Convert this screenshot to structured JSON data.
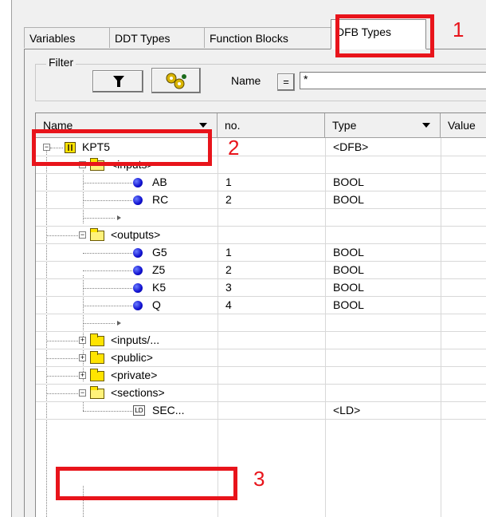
{
  "tabs": [
    {
      "label": "Variables"
    },
    {
      "label": "DDT Types"
    },
    {
      "label": "Function Blocks"
    },
    {
      "label": "DFB Types"
    }
  ],
  "filter": {
    "legend": "Filter",
    "name_label": "Name",
    "eq_label": "=",
    "name_value": "*"
  },
  "columns": [
    {
      "label": "Name"
    },
    {
      "label": "no."
    },
    {
      "label": "Type"
    },
    {
      "label": "Value"
    }
  ],
  "rows": [
    {
      "name": "KPT5",
      "no": "",
      "type": "<DFB>"
    },
    {
      "name": "<inputs>",
      "no": "",
      "type": ""
    },
    {
      "name": "AB",
      "no": "1",
      "type": "BOOL"
    },
    {
      "name": "RC",
      "no": "2",
      "type": "BOOL"
    },
    {
      "name": "",
      "no": "",
      "type": ""
    },
    {
      "name": "<outputs>",
      "no": "",
      "type": ""
    },
    {
      "name": "G5",
      "no": "1",
      "type": "BOOL"
    },
    {
      "name": "Z5",
      "no": "2",
      "type": "BOOL"
    },
    {
      "name": "K5",
      "no": "3",
      "type": "BOOL"
    },
    {
      "name": "Q",
      "no": "4",
      "type": "BOOL"
    },
    {
      "name": "",
      "no": "",
      "type": ""
    },
    {
      "name": "<inputs/...",
      "no": "",
      "type": ""
    },
    {
      "name": "<public>",
      "no": "",
      "type": ""
    },
    {
      "name": "<private>",
      "no": "",
      "type": ""
    },
    {
      "name": "<sections>",
      "no": "",
      "type": ""
    },
    {
      "name": "SEC...",
      "no": "",
      "type": "<LD>"
    }
  ],
  "annotations": [
    {
      "number": "1"
    },
    {
      "number": "2"
    },
    {
      "number": "3"
    }
  ],
  "colors": {
    "annotation": "#e8141b",
    "folder": "#ffe400",
    "variable_dot": "#1010d0"
  },
  "icons": {
    "filter_button": "funnel-icon",
    "settings_button": "gears-icon",
    "dfb": "dfb-block-icon",
    "folder": "folder-icon",
    "variable": "blue-dot-icon",
    "section": "ld-section-icon"
  }
}
